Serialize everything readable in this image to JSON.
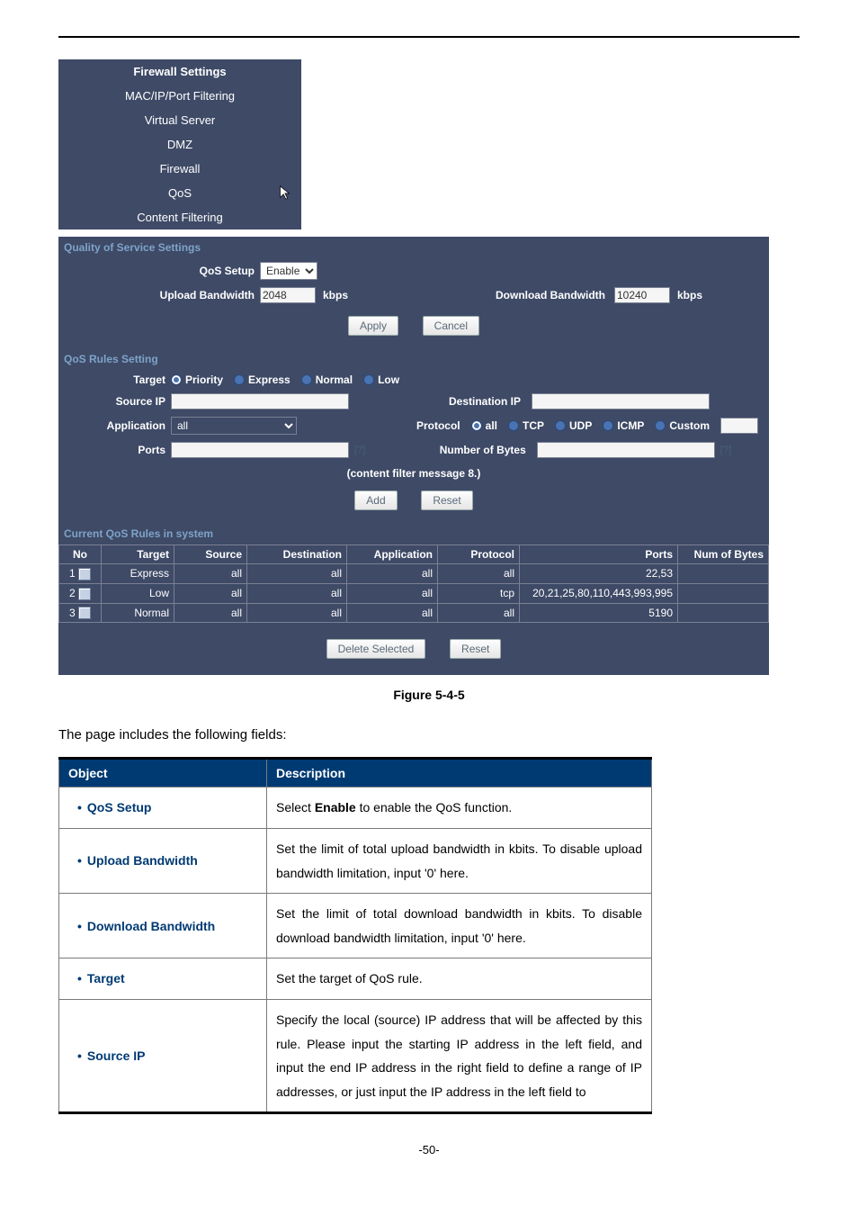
{
  "nav": {
    "header": "Firewall Settings",
    "items": [
      "MAC/IP/Port Filtering",
      "Virtual Server",
      "DMZ",
      "Firewall",
      "QoS",
      "Content Filtering"
    ],
    "cursor_on_index": 4
  },
  "qos_settings": {
    "title": "Quality of Service Settings",
    "setup_label": "QoS Setup",
    "setup_value": "Enable",
    "upload_label": "Upload Bandwidth",
    "upload_value": "2048",
    "download_label": "Download Bandwidth",
    "download_value": "10240",
    "unit": "kbps",
    "apply": "Apply",
    "cancel": "Cancel"
  },
  "rules_setting": {
    "title": "QoS Rules Setting",
    "target_label": "Target",
    "targets": [
      "Priority",
      "Express",
      "Normal",
      "Low"
    ],
    "target_selected_index": 0,
    "source_ip_label": "Source IP",
    "source_ip_value": "",
    "destination_ip_label": "Destination IP",
    "destination_ip_value": "",
    "application_label": "Application",
    "application_value": "all",
    "protocol_label": "Protocol",
    "protocols": [
      "all",
      "TCP",
      "UDP",
      "ICMP",
      "Custom"
    ],
    "protocol_selected_index": 0,
    "protocol_custom_value": "",
    "ports_label": "Ports",
    "ports_value": "",
    "bytes_label": "Number of Bytes",
    "bytes_value": "",
    "help_marker": "[?]",
    "message": "(content filter message 8.)",
    "add": "Add",
    "reset": "Reset"
  },
  "current_rules": {
    "title": "Current QoS Rules in system",
    "headers": [
      "No",
      "Target",
      "Source",
      "Destination",
      "Application",
      "Protocol",
      "Ports",
      "Num of Bytes"
    ],
    "rows": [
      {
        "no": "1",
        "target": "Express",
        "source": "all",
        "dest": "all",
        "app": "all",
        "proto": "all",
        "ports": "22,53",
        "bytes": ""
      },
      {
        "no": "2",
        "target": "Low",
        "source": "all",
        "dest": "all",
        "app": "all",
        "proto": "tcp",
        "ports": "20,21,25,80,110,443,993,995",
        "bytes": ""
      },
      {
        "no": "3",
        "target": "Normal",
        "source": "all",
        "dest": "all",
        "app": "all",
        "proto": "all",
        "ports": "5190",
        "bytes": ""
      }
    ],
    "delete": "Delete Selected",
    "reset": "Reset"
  },
  "figure_caption": "Figure 5-4-5",
  "paragraph": "The page includes the following fields:",
  "description_table": {
    "headers": [
      "Object",
      "Description"
    ],
    "rows": [
      {
        "obj": "QoS Setup",
        "desc_parts": [
          "Select ",
          "Enable",
          " to enable the QoS function."
        ],
        "bold_index": 1,
        "justify": false
      },
      {
        "obj": "Upload Bandwidth",
        "desc": "Set the limit of total upload bandwidth in kbits. To disable upload bandwidth limitation, input '0' here.",
        "justify": true
      },
      {
        "obj": "Download Bandwidth",
        "desc": "Set the limit of total download bandwidth in kbits. To disable download bandwidth limitation, input '0' here.",
        "justify": true
      },
      {
        "obj": "Target",
        "desc": "Set the target of QoS rule.",
        "justify": false
      },
      {
        "obj": "Source IP",
        "desc": "Specify the local (source) IP address that will be affected by this rule. Please input the starting IP address in the left field, and input the end IP address in the right field to define a range of IP addresses, or just input the IP address in the left field to",
        "justify": true
      }
    ]
  },
  "footer": "-50-"
}
